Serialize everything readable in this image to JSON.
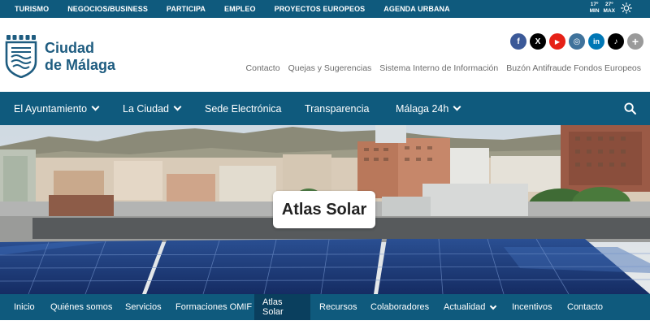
{
  "topbar": {
    "links": [
      "TURISMO",
      "NEGOCIOS/BUSINESS",
      "PARTICIPA",
      "EMPLEO",
      "PROYECTOS EUROPEOS",
      "AGENDA URBANA"
    ],
    "weather": {
      "min_value": "17º",
      "min_label": "MIN",
      "max_value": "27º",
      "max_label": "MAX",
      "icon": "sun-icon"
    }
  },
  "header": {
    "brand_line1": "Ciudad",
    "brand_line2": "de Málaga",
    "social": [
      {
        "name": "facebook-icon",
        "glyph": "f",
        "color": "#3b5998"
      },
      {
        "name": "x-icon",
        "glyph": "X",
        "color": "#000000"
      },
      {
        "name": "youtube-icon",
        "glyph": "▶",
        "color": "#e62117"
      },
      {
        "name": "instagram-icon",
        "glyph": "◎",
        "color": "#3f729b"
      },
      {
        "name": "linkedin-icon",
        "glyph": "in",
        "color": "#0077b5"
      },
      {
        "name": "tiktok-icon",
        "glyph": "♪",
        "color": "#000000"
      },
      {
        "name": "more-icon",
        "glyph": "+",
        "color": "#9a9a9a"
      }
    ],
    "sublinks": [
      "Contacto",
      "Quejas y Sugerencias",
      "Sistema Interno de Información",
      "Buzón Antifraude Fondos Europeos"
    ]
  },
  "mainnav": {
    "items": [
      {
        "label": "El Ayuntamiento",
        "dropdown": true
      },
      {
        "label": "La Ciudad",
        "dropdown": true
      },
      {
        "label": "Sede Electrónica",
        "dropdown": false
      },
      {
        "label": "Transparencia",
        "dropdown": false
      },
      {
        "label": "Málaga 24h",
        "dropdown": true
      }
    ]
  },
  "hero": {
    "title": "Atlas Solar"
  },
  "subnav": {
    "items": [
      {
        "label": "Inicio",
        "active": false,
        "dropdown": false
      },
      {
        "label": "Quiénes somos",
        "active": false,
        "dropdown": false
      },
      {
        "label": "Servicios",
        "active": false,
        "dropdown": false
      },
      {
        "label": "Formaciones OMIF",
        "active": false,
        "dropdown": false
      },
      {
        "label": "Atlas Solar",
        "active": true,
        "dropdown": false
      },
      {
        "label": "Recursos",
        "active": false,
        "dropdown": false
      },
      {
        "label": "Colaboradores",
        "active": false,
        "dropdown": false
      },
      {
        "label": "Actualidad",
        "active": false,
        "dropdown": true
      },
      {
        "label": "Incentivos",
        "active": false,
        "dropdown": false
      },
      {
        "label": "Contacto",
        "active": false,
        "dropdown": false
      }
    ]
  },
  "colors": {
    "primary": "#0f5a7d",
    "active": "#0a3f5e",
    "brand_text": "#1e5c80"
  }
}
